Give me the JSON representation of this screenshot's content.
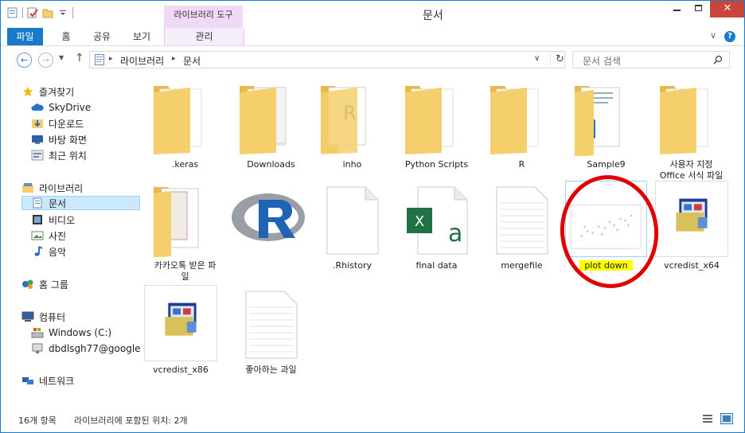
{
  "window": {
    "title": "문서",
    "close_glyph": "✕",
    "context_tab_group": "라이브러리 도구"
  },
  "ribbon": {
    "tabs": [
      "파일",
      "홈",
      "공유",
      "보기",
      "관리"
    ],
    "collapse_glyph": "∨",
    "help_glyph": "?"
  },
  "address": {
    "back_glyph": "←",
    "forward_glyph": "→",
    "recent_glyph": "▼",
    "up_glyph": "↑",
    "crumbs": [
      "라이브러리",
      "문서"
    ],
    "crumb_sep": "▸",
    "dropdown_glyph": "∨",
    "refresh_glyph": "↻",
    "search_placeholder": "문서 검색"
  },
  "nav": {
    "favorites": {
      "label": "즐겨찾기",
      "items": [
        "SkyDrive",
        "다운로드",
        "바탕 화면",
        "최근 위치"
      ]
    },
    "libraries": {
      "label": "라이브러리",
      "items": [
        "문서",
        "비디오",
        "사진",
        "음악"
      ],
      "selected": "문서"
    },
    "homegroup": "홈 그룹",
    "computer": {
      "label": "컴퓨터",
      "items": [
        "Windows (C:)",
        "dbdlsgh77@google"
      ]
    },
    "network": "네트워크"
  },
  "files": [
    {
      "name": ".keras",
      "kind": "folder-blank"
    },
    {
      "name": "Downloads",
      "kind": "folder-docs"
    },
    {
      "name": "inho",
      "kind": "folder-doc-r"
    },
    {
      "name": "Python Scripts",
      "kind": "folder-blank"
    },
    {
      "name": "R",
      "kind": "folder-blank"
    },
    {
      "name": "Sample9",
      "kind": "folder-hwp"
    },
    {
      "name": "사용자 지정\nOffice 서식 파일",
      "kind": "folder-blank"
    },
    {
      "name": "카카오톡 받은 파\n일",
      "kind": "folder-hwp-docs"
    },
    {
      "name": "",
      "kind": "r-logo"
    },
    {
      "name": ".Rhistory",
      "kind": "blank-file"
    },
    {
      "name": "final data",
      "kind": "excel"
    },
    {
      "name": "mergefile",
      "kind": "lined-file"
    },
    {
      "name": "plot down",
      "kind": "plot",
      "highlighted": true
    },
    {
      "name": "vcredist_x64",
      "kind": "installer"
    },
    {
      "name": "vcredist_x86",
      "kind": "installer"
    },
    {
      "name": "좋아하는 과일",
      "kind": "lined-file"
    }
  ],
  "status": {
    "count": "16개 항목",
    "location": "라이브러리에 포함된 위치: 2개"
  },
  "colors": {
    "accent": "#1979ca",
    "folder": "#f5cf6b",
    "annotation": "#e10000",
    "highlight": "#ffff00",
    "excel": "#1f7244",
    "context_tab": "#f0d9f5"
  }
}
